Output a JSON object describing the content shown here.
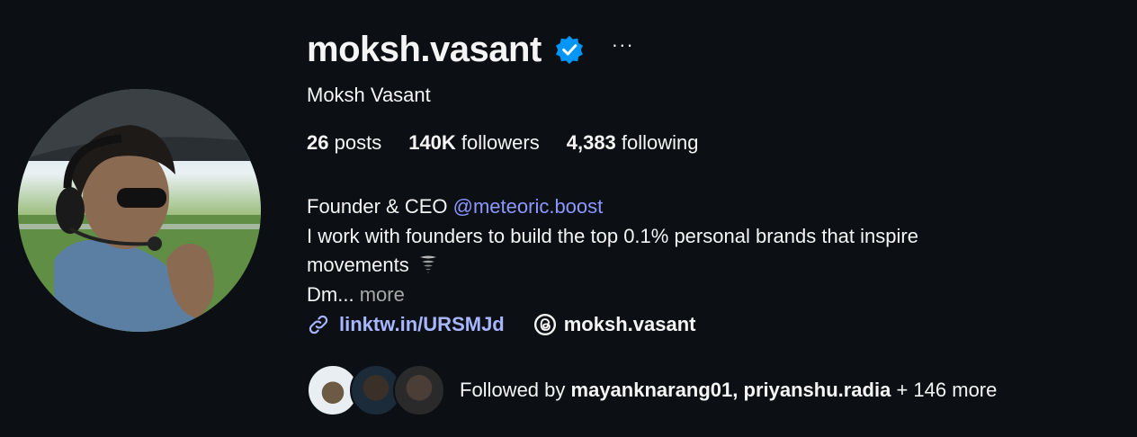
{
  "profile": {
    "username": "moksh.vasant",
    "full_name": "Moksh Vasant",
    "verified": true,
    "more_options_label": "···"
  },
  "stats": {
    "posts_count": "26",
    "posts_label": "posts",
    "followers_count": "140K",
    "followers_label": "followers",
    "following_count": "4,383",
    "following_label": "following"
  },
  "bio": {
    "line1_text": "Founder & CEO",
    "line1_mention": "@meteoric.boost",
    "line2": "I work with founders to build the top 0.1% personal brands that inspire",
    "line3": "movements",
    "line3_emoji": "tornado-emoji",
    "line4": "Dm...",
    "more_label": "more"
  },
  "links": {
    "website": "linktw.in/URSMJd",
    "threads_handle": "moksh.vasant"
  },
  "followed_by": {
    "prefix": "Followed by",
    "names": "mayanknarang01, priyanshu.radia",
    "suffix": "+ 146 more"
  },
  "colors": {
    "background": "#0c1014",
    "verified_blue": "#0095f6",
    "mention": "#8c97ff",
    "link": "#a8b5ff",
    "muted": "#a8a8a8"
  }
}
